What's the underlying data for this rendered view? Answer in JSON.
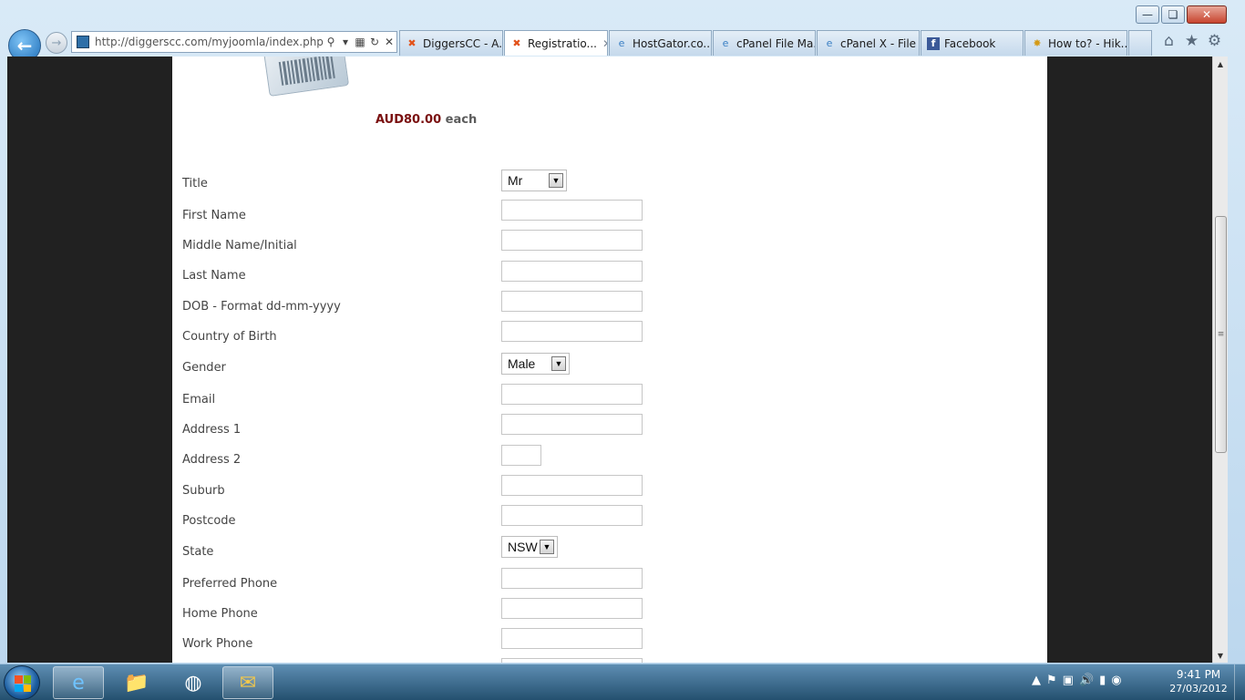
{
  "browser": {
    "address": "http://diggerscc.com/myjoomla/index.php/or",
    "tabs": [
      {
        "label": "DiggersCC - A...",
        "icon": "joomla-icon",
        "active": false
      },
      {
        "label": "Registratio...",
        "icon": "joomla-icon",
        "active": true
      },
      {
        "label": "HostGator.co...",
        "icon": "ie-page-icon",
        "active": false
      },
      {
        "label": "cPanel File Ma...",
        "icon": "ie-page-icon",
        "active": false
      },
      {
        "label": "cPanel X - File ...",
        "icon": "ie-page-icon",
        "active": false
      },
      {
        "label": "Facebook",
        "icon": "facebook-icon",
        "active": false
      },
      {
        "label": "How to? - Hik...",
        "icon": "site-icon",
        "active": false
      }
    ]
  },
  "product": {
    "price": "AUD80.00",
    "unit": "each"
  },
  "form": {
    "title_label": "Title",
    "title_value": "Mr",
    "first_name_label": "First Name",
    "middle_name_label": "Middle Name/Initial",
    "last_name_label": "Last Name",
    "dob_label": "DOB - Format dd-mm-yyyy",
    "country_label": "Country of Birth",
    "gender_label": "Gender",
    "gender_value": "Male",
    "email_label": "Email",
    "address1_label": "Address 1",
    "address2_label": "Address 2",
    "suburb_label": "Suburb",
    "postcode_label": "Postcode",
    "state_label": "State",
    "state_value": "NSW",
    "preferred_phone_label": "Preferred Phone",
    "home_phone_label": "Home Phone",
    "work_phone_label": "Work Phone"
  },
  "taskbar": {
    "time": "9:41 PM",
    "date": "27/03/2012"
  },
  "colors": {
    "price": "#7a1010",
    "page_bg": "#ffffff",
    "side_bg": "#212121"
  }
}
